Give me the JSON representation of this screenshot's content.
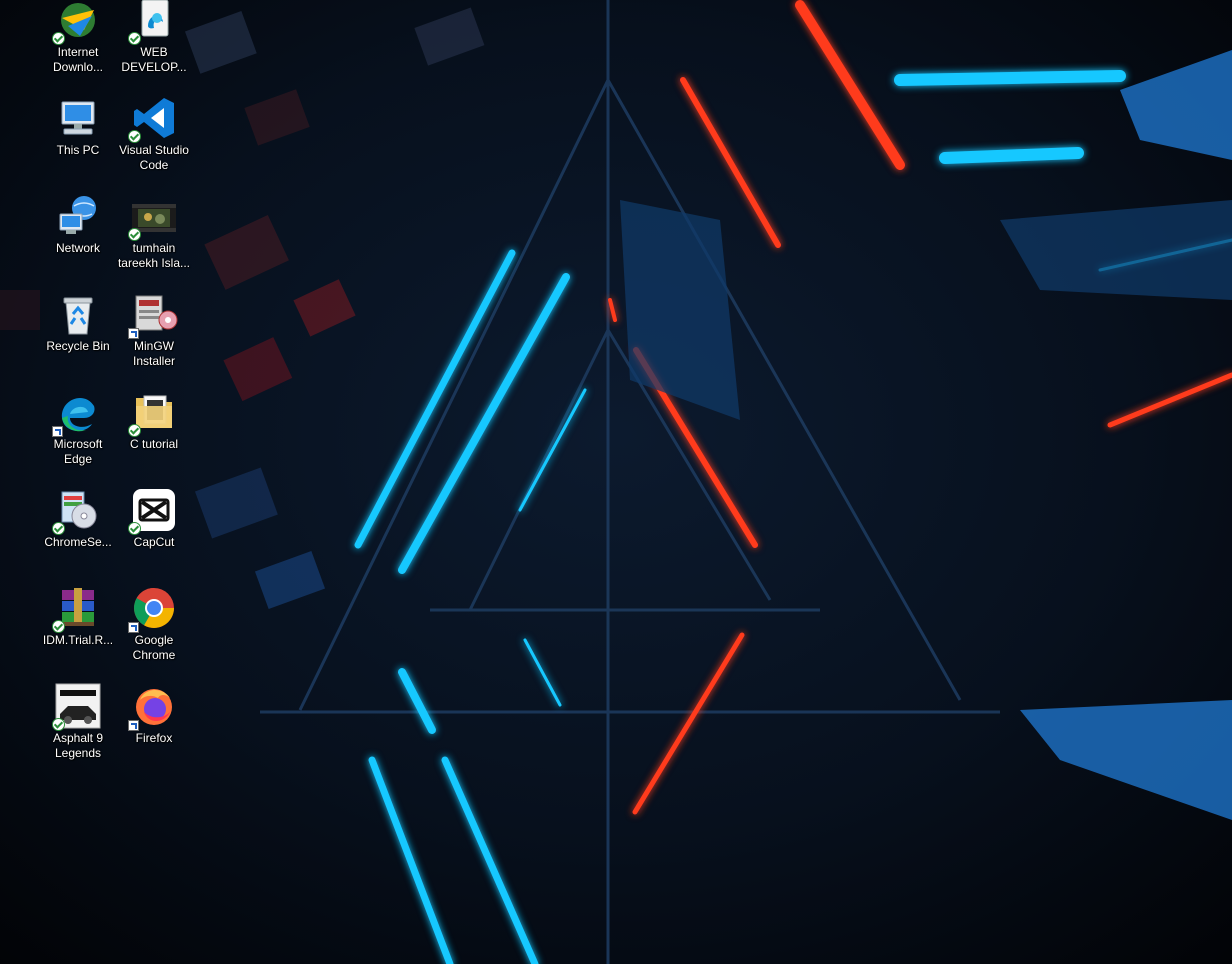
{
  "desktop": {
    "icons": [
      {
        "label": "Internet\nDownlo...",
        "icon": "idm-icon",
        "overlay": "sync"
      },
      {
        "label": "WEB\nDEVELOP...",
        "icon": "edge-document-icon",
        "overlay": "sync"
      },
      {
        "label": "This PC",
        "icon": "computer-icon",
        "overlay": "none"
      },
      {
        "label": "Visual Studio\nCode",
        "icon": "vscode-icon",
        "overlay": "sync"
      },
      {
        "label": "Network",
        "icon": "network-icon",
        "overlay": "none"
      },
      {
        "label": "tumhain\ntareekh Isla...",
        "icon": "video-file-icon",
        "overlay": "sync"
      },
      {
        "label": "Recycle Bin",
        "icon": "recycle-bin-icon",
        "overlay": "none"
      },
      {
        "label": "MinGW\nInstaller",
        "icon": "installer-icon",
        "overlay": "shortcut"
      },
      {
        "label": "Microsoft\nEdge",
        "icon": "edge-icon",
        "overlay": "shortcut"
      },
      {
        "label": "C tutorial",
        "icon": "folder-icon",
        "overlay": "sync"
      },
      {
        "label": "ChromeSe...",
        "icon": "setup-disc-icon",
        "overlay": "sync"
      },
      {
        "label": "CapCut",
        "icon": "capcut-icon",
        "overlay": "sync"
      },
      {
        "label": "IDM.Trial.R...",
        "icon": "winrar-icon",
        "overlay": "sync"
      },
      {
        "label": "Google\nChrome",
        "icon": "chrome-icon",
        "overlay": "shortcut"
      },
      {
        "label": "Asphalt 9\nLegends",
        "icon": "asphalt-icon",
        "overlay": "sync"
      },
      {
        "label": "Firefox",
        "icon": "firefox-icon",
        "overlay": "shortcut"
      }
    ]
  },
  "colors": {
    "wallpaper_cyan": "#19c8ff",
    "wallpaper_red": "#ff3a1c",
    "wallpaper_bg": "#05070c"
  }
}
